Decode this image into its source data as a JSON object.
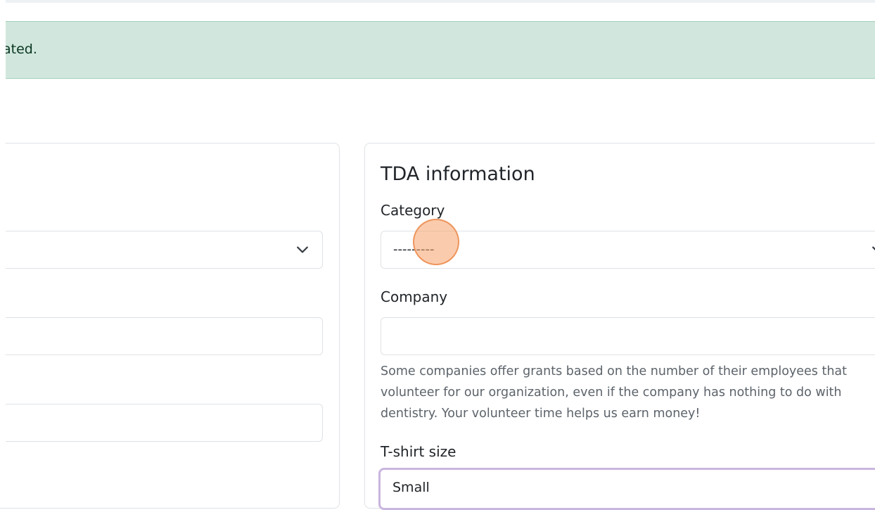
{
  "alert": {
    "message": "ated."
  },
  "tda_card": {
    "title": "TDA information",
    "category": {
      "label": "Category",
      "selected": "---------"
    },
    "company": {
      "label": "Company",
      "value": "",
      "help": "Some companies offer grants based on the number of their employees that volunteer for our organization, even if the company has nothing to do with dentistry. Your volunteer time helps us earn money!"
    },
    "tshirt": {
      "label": "T-shirt size",
      "selected": "Small"
    }
  },
  "colors": {
    "alert_bg": "#d1e7dd",
    "alert_text": "#0a3622",
    "card_border": "#dee2e6",
    "focus_border": "#c9b6de",
    "cursor": "#f6a36a"
  },
  "icons": {
    "select_chevron": "chevron-down-icon",
    "cursor_indicator": "click-highlight"
  }
}
